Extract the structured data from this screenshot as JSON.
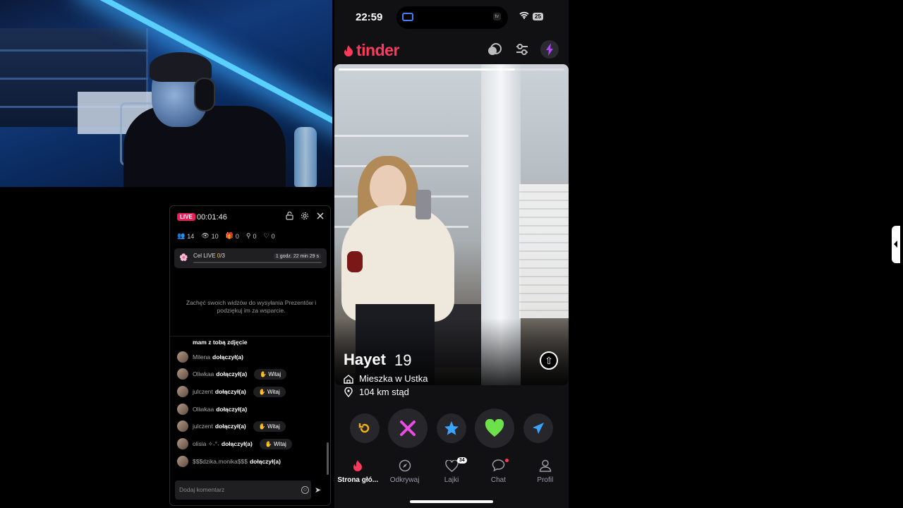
{
  "live": {
    "badge": "LIVE",
    "timer": "00:01:46",
    "stats": {
      "viewers": "14",
      "views": "10",
      "gifts": "0",
      "shares": "0",
      "likes": "0"
    },
    "goal": {
      "label_prefix": "Cel LIVE ",
      "progress": "0",
      "total": "/3",
      "time_left": "1 godz. 22 min 29 s"
    },
    "encourage": "Zachęć swoich widzów do wysyłania Prezentów i podziękuj im za wsparcie.",
    "partial_comment": "mam z tobą zdjęcie",
    "joined_label": "dołączył(a)",
    "wave_label": "Witaj",
    "comments": [
      {
        "name": "Milena"
      },
      {
        "name": "Oliwkaa"
      },
      {
        "name": "julczent"
      },
      {
        "name": "Oliwkaa"
      },
      {
        "name": "julczent"
      },
      {
        "name": "olisia ✧˖°˖"
      },
      {
        "name": "$$$dzika.monika$$$"
      }
    ],
    "input_placeholder": "Dodaj komentarz"
  },
  "phone": {
    "time": "22:59",
    "battery": "25",
    "island_label": "tv",
    "logo": "tinder",
    "profile": {
      "name": "Hayet",
      "age": "19",
      "lives_in": "Mieszka w Ustka",
      "distance": "104 km stąd",
      "photo_progress": 0.78
    },
    "nav": [
      {
        "label": "Strona głó..."
      },
      {
        "label": "Odkrywaj"
      },
      {
        "label": "Lajki",
        "badge": "34"
      },
      {
        "label": "Chat"
      },
      {
        "label": "Profil"
      }
    ]
  },
  "colors": {
    "tinder_pink": "#fd3a5c",
    "live_red": "#ea1e5a",
    "rewind": "#f5b312",
    "nope": "#e94de1",
    "superlike": "#3ba4ff",
    "like": "#6ee04b",
    "boost": "#b047ff"
  }
}
